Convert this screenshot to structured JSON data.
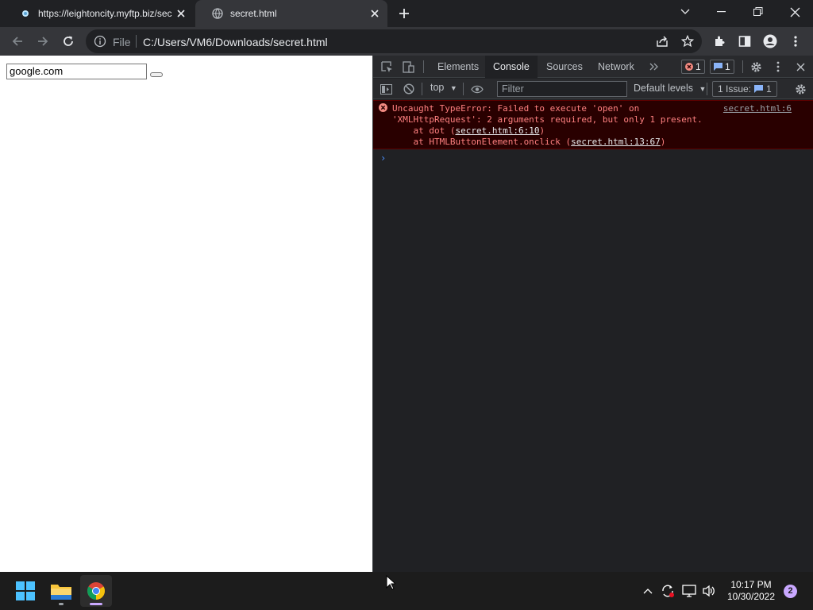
{
  "browser": {
    "tabs": [
      {
        "title": "https://leightoncity.myftp.biz/sec",
        "active": false
      },
      {
        "title": "secret.html",
        "active": true
      }
    ],
    "omnibox": {
      "scheme_label": "File",
      "url": "C:/Users/VM6/Downloads/secret.html"
    }
  },
  "page": {
    "input_value": "google.com"
  },
  "devtools": {
    "tabs": [
      "Elements",
      "Console",
      "Sources",
      "Network"
    ],
    "active_tab": "Console",
    "error_count": "1",
    "message_count": "1",
    "context": "top",
    "filter_placeholder": "Filter",
    "levels": "Default levels",
    "issues_label": "1 Issue:",
    "issues_count": "1",
    "error": {
      "line1": "Uncaught TypeError: Failed to execute 'open' on",
      "line2": "'XMLHttpRequest': 2 arguments required, but only 1 present.",
      "line3_prefix": "    at dot (",
      "line3_link": "secret.html:6:10",
      "line3_suffix": ")",
      "line4_prefix": "    at HTMLButtonElement.onclick (",
      "line4_link": "secret.html:13:67",
      "line4_suffix": ")",
      "source": "secret.html:6"
    },
    "prompt": "›"
  },
  "taskbar": {
    "time": "10:17 PM",
    "date": "10/30/2022",
    "notification_count": "2"
  },
  "colors": {
    "accent": "#8ab4f8",
    "error_bg": "#290000",
    "error_text": "#ff8080"
  }
}
